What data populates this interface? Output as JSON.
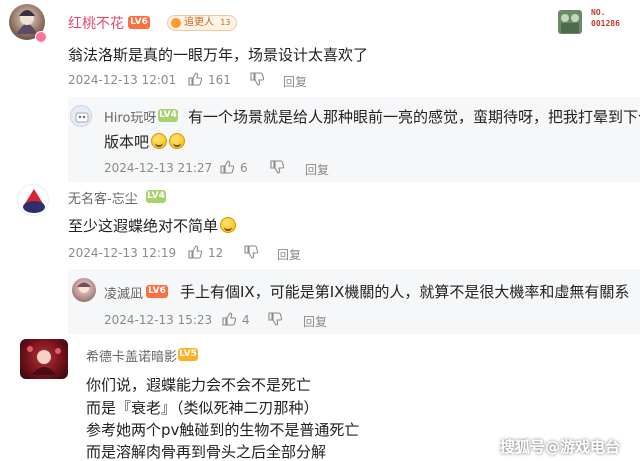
{
  "comments": [
    {
      "user": "红桃不花",
      "level": "LV6",
      "medal": "追更人",
      "medal_num": "13",
      "text": "翁法洛斯是真的一眼万年，场景设计太喜欢了",
      "date": "2024-12-13 12:01",
      "likes": "161",
      "reply_label": "回复",
      "fan_badge": {
        "label": "NO.",
        "number": "001286"
      }
    },
    {
      "user": "Hiro玩呀",
      "level": "LV4",
      "text_line1": "有一个场景就是给人那种眼前一亮的感觉，蛮期待呀，把我打晕到下个",
      "text_line2": "版本吧",
      "date": "2024-12-13 21:27",
      "likes": "6",
      "reply_label": "回复"
    },
    {
      "user": "无名客-忘尘",
      "level": "LV4",
      "text": "至少这遐蝶绝对不简单",
      "date": "2024-12-13 12:19",
      "likes": "12",
      "reply_label": "回复"
    },
    {
      "user": "凌滅凪",
      "level": "LV6",
      "text": "手上有個IX，可能是第IX機關的人，就算不是很大機率和虛無有關系",
      "date": "2024-12-13 15:23",
      "likes": "4",
      "reply_label": "回复"
    },
    {
      "user": "希德卡盖诺暗影",
      "level": "LV5",
      "lines": [
        "你们说，遐蝶能力会不会不是死亡",
        "而是『衰老』（类似死神二刃那种）",
        "参考她两个pv触碰到的生物不是普通死亡",
        "而是溶解肉骨再到骨头之后全部分解"
      ]
    }
  ],
  "watermark": "搜狐号@游戏电台",
  "colors": {
    "name_pink": "#e8496b",
    "meta_gray": "#8a8a8a",
    "lv6": "#ff6e40",
    "lv5": "#ffb027"
  },
  "icons": [
    "thumb-up-icon",
    "thumb-down-icon",
    "laugh-emoji-icon"
  ]
}
